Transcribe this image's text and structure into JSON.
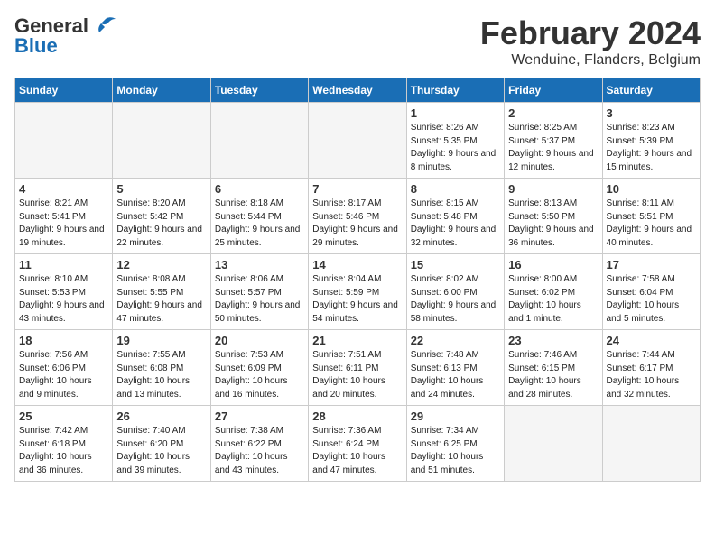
{
  "header": {
    "logo_general": "General",
    "logo_blue": "Blue",
    "month": "February 2024",
    "location": "Wenduine, Flanders, Belgium"
  },
  "weekdays": [
    "Sunday",
    "Monday",
    "Tuesday",
    "Wednesday",
    "Thursday",
    "Friday",
    "Saturday"
  ],
  "weeks": [
    [
      {
        "day": "",
        "info": ""
      },
      {
        "day": "",
        "info": ""
      },
      {
        "day": "",
        "info": ""
      },
      {
        "day": "",
        "info": ""
      },
      {
        "day": "1",
        "info": "Sunrise: 8:26 AM\nSunset: 5:35 PM\nDaylight: 9 hours\nand 8 minutes."
      },
      {
        "day": "2",
        "info": "Sunrise: 8:25 AM\nSunset: 5:37 PM\nDaylight: 9 hours\nand 12 minutes."
      },
      {
        "day": "3",
        "info": "Sunrise: 8:23 AM\nSunset: 5:39 PM\nDaylight: 9 hours\nand 15 minutes."
      }
    ],
    [
      {
        "day": "4",
        "info": "Sunrise: 8:21 AM\nSunset: 5:41 PM\nDaylight: 9 hours\nand 19 minutes."
      },
      {
        "day": "5",
        "info": "Sunrise: 8:20 AM\nSunset: 5:42 PM\nDaylight: 9 hours\nand 22 minutes."
      },
      {
        "day": "6",
        "info": "Sunrise: 8:18 AM\nSunset: 5:44 PM\nDaylight: 9 hours\nand 25 minutes."
      },
      {
        "day": "7",
        "info": "Sunrise: 8:17 AM\nSunset: 5:46 PM\nDaylight: 9 hours\nand 29 minutes."
      },
      {
        "day": "8",
        "info": "Sunrise: 8:15 AM\nSunset: 5:48 PM\nDaylight: 9 hours\nand 32 minutes."
      },
      {
        "day": "9",
        "info": "Sunrise: 8:13 AM\nSunset: 5:50 PM\nDaylight: 9 hours\nand 36 minutes."
      },
      {
        "day": "10",
        "info": "Sunrise: 8:11 AM\nSunset: 5:51 PM\nDaylight: 9 hours\nand 40 minutes."
      }
    ],
    [
      {
        "day": "11",
        "info": "Sunrise: 8:10 AM\nSunset: 5:53 PM\nDaylight: 9 hours\nand 43 minutes."
      },
      {
        "day": "12",
        "info": "Sunrise: 8:08 AM\nSunset: 5:55 PM\nDaylight: 9 hours\nand 47 minutes."
      },
      {
        "day": "13",
        "info": "Sunrise: 8:06 AM\nSunset: 5:57 PM\nDaylight: 9 hours\nand 50 minutes."
      },
      {
        "day": "14",
        "info": "Sunrise: 8:04 AM\nSunset: 5:59 PM\nDaylight: 9 hours\nand 54 minutes."
      },
      {
        "day": "15",
        "info": "Sunrise: 8:02 AM\nSunset: 6:00 PM\nDaylight: 9 hours\nand 58 minutes."
      },
      {
        "day": "16",
        "info": "Sunrise: 8:00 AM\nSunset: 6:02 PM\nDaylight: 10 hours\nand 1 minute."
      },
      {
        "day": "17",
        "info": "Sunrise: 7:58 AM\nSunset: 6:04 PM\nDaylight: 10 hours\nand 5 minutes."
      }
    ],
    [
      {
        "day": "18",
        "info": "Sunrise: 7:56 AM\nSunset: 6:06 PM\nDaylight: 10 hours\nand 9 minutes."
      },
      {
        "day": "19",
        "info": "Sunrise: 7:55 AM\nSunset: 6:08 PM\nDaylight: 10 hours\nand 13 minutes."
      },
      {
        "day": "20",
        "info": "Sunrise: 7:53 AM\nSunset: 6:09 PM\nDaylight: 10 hours\nand 16 minutes."
      },
      {
        "day": "21",
        "info": "Sunrise: 7:51 AM\nSunset: 6:11 PM\nDaylight: 10 hours\nand 20 minutes."
      },
      {
        "day": "22",
        "info": "Sunrise: 7:48 AM\nSunset: 6:13 PM\nDaylight: 10 hours\nand 24 minutes."
      },
      {
        "day": "23",
        "info": "Sunrise: 7:46 AM\nSunset: 6:15 PM\nDaylight: 10 hours\nand 28 minutes."
      },
      {
        "day": "24",
        "info": "Sunrise: 7:44 AM\nSunset: 6:17 PM\nDaylight: 10 hours\nand 32 minutes."
      }
    ],
    [
      {
        "day": "25",
        "info": "Sunrise: 7:42 AM\nSunset: 6:18 PM\nDaylight: 10 hours\nand 36 minutes."
      },
      {
        "day": "26",
        "info": "Sunrise: 7:40 AM\nSunset: 6:20 PM\nDaylight: 10 hours\nand 39 minutes."
      },
      {
        "day": "27",
        "info": "Sunrise: 7:38 AM\nSunset: 6:22 PM\nDaylight: 10 hours\nand 43 minutes."
      },
      {
        "day": "28",
        "info": "Sunrise: 7:36 AM\nSunset: 6:24 PM\nDaylight: 10 hours\nand 47 minutes."
      },
      {
        "day": "29",
        "info": "Sunrise: 7:34 AM\nSunset: 6:25 PM\nDaylight: 10 hours\nand 51 minutes."
      },
      {
        "day": "",
        "info": ""
      },
      {
        "day": "",
        "info": ""
      }
    ]
  ]
}
